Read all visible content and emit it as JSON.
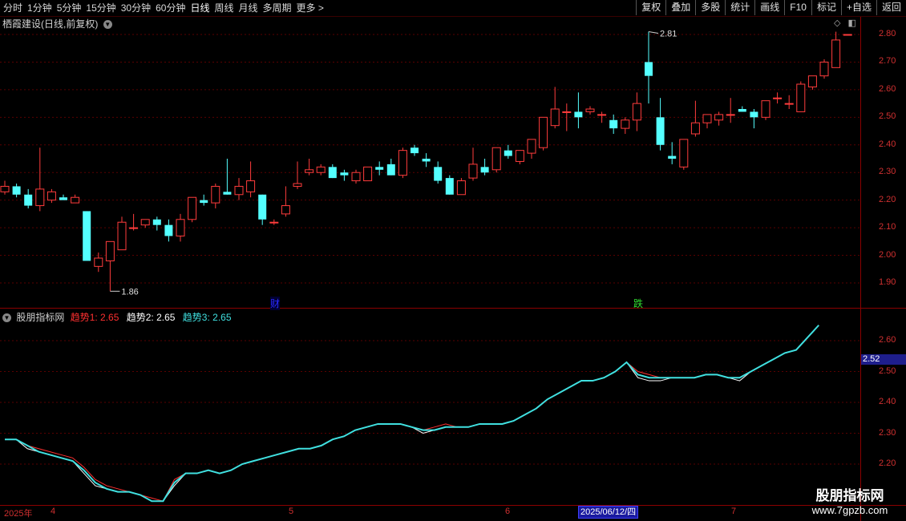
{
  "toolbar": {
    "periods": [
      "分时",
      "1分钟",
      "5分钟",
      "15分钟",
      "30分钟",
      "60分钟",
      "日线",
      "周线",
      "月线",
      "多周期",
      "更多 >"
    ],
    "active": "日线",
    "right_buttons": [
      "复权",
      "叠加",
      "多股",
      "统计",
      "画线",
      "F10",
      "标记",
      "+自选",
      "返回"
    ]
  },
  "stock": {
    "title": "栖霞建设(日线,前复权)"
  },
  "price_axis": {
    "ticks": [
      "2.80",
      "2.70",
      "2.60",
      "2.50",
      "2.40",
      "2.30",
      "2.20",
      "2.10",
      "2.00",
      "1.90"
    ],
    "min": 1.86,
    "max": 2.81
  },
  "annotations": {
    "high": "2.81",
    "low": "1.86",
    "marker_cai": "财",
    "marker_die": "跌"
  },
  "indicator": {
    "name": "股朋指标网",
    "series_labels": [
      "趋势1: 2.65",
      "趋势2: 2.65",
      "趋势3: 2.65"
    ],
    "colors": [
      "#ff3030",
      "#ffffff",
      "#40e0e0"
    ],
    "axis_ticks": [
      "2.60",
      "2.50",
      "2.40",
      "2.30",
      "2.20"
    ],
    "current_value": "2.52"
  },
  "dates": {
    "labels": [
      "2025年",
      "4",
      "5",
      "6",
      "2025/06/12/四",
      "7"
    ]
  },
  "watermark": {
    "title": "股朋指标网",
    "url": "www.7gpzb.com"
  },
  "chart_data": {
    "type": "candlestick",
    "ohlc": [
      [
        2.23,
        2.27,
        2.22,
        2.25
      ],
      [
        2.25,
        2.26,
        2.21,
        2.22
      ],
      [
        2.22,
        2.24,
        2.17,
        2.18
      ],
      [
        2.18,
        2.39,
        2.16,
        2.24
      ],
      [
        2.2,
        2.24,
        2.19,
        2.23
      ],
      [
        2.21,
        2.22,
        2.2,
        2.2
      ],
      [
        2.19,
        2.22,
        2.19,
        2.21
      ],
      [
        2.16,
        2.16,
        2.02,
        1.98
      ],
      [
        1.96,
        2.01,
        1.94,
        1.99
      ],
      [
        1.98,
        2.05,
        1.87,
        2.05
      ],
      [
        2.02,
        2.14,
        2.02,
        2.12
      ],
      [
        2.1,
        2.15,
        2.09,
        2.1
      ],
      [
        2.11,
        2.13,
        2.1,
        2.13
      ],
      [
        2.13,
        2.14,
        2.09,
        2.11
      ],
      [
        2.11,
        2.13,
        2.05,
        2.07
      ],
      [
        2.07,
        2.15,
        2.05,
        2.13
      ],
      [
        2.13,
        2.21,
        2.12,
        2.21
      ],
      [
        2.2,
        2.22,
        2.18,
        2.19
      ],
      [
        2.19,
        2.26,
        2.17,
        2.25
      ],
      [
        2.23,
        2.35,
        2.22,
        2.22
      ],
      [
        2.22,
        2.28,
        2.2,
        2.25
      ],
      [
        2.23,
        2.34,
        2.21,
        2.27
      ],
      [
        2.22,
        2.22,
        2.11,
        2.13
      ],
      [
        2.12,
        2.13,
        2.11,
        2.12
      ],
      [
        2.15,
        2.25,
        2.14,
        2.18
      ],
      [
        2.25,
        2.34,
        2.24,
        2.26
      ],
      [
        2.3,
        2.35,
        2.29,
        2.31
      ],
      [
        2.3,
        2.33,
        2.29,
        2.32
      ],
      [
        2.32,
        2.33,
        2.28,
        2.28
      ],
      [
        2.3,
        2.31,
        2.27,
        2.29
      ],
      [
        2.27,
        2.31,
        2.26,
        2.3
      ],
      [
        2.27,
        2.32,
        2.27,
        2.32
      ],
      [
        2.32,
        2.34,
        2.29,
        2.31
      ],
      [
        2.33,
        2.35,
        2.29,
        2.29
      ],
      [
        2.29,
        2.39,
        2.28,
        2.38
      ],
      [
        2.39,
        2.4,
        2.36,
        2.37
      ],
      [
        2.35,
        2.37,
        2.32,
        2.34
      ],
      [
        2.32,
        2.34,
        2.26,
        2.27
      ],
      [
        2.28,
        2.29,
        2.22,
        2.22
      ],
      [
        2.22,
        2.28,
        2.22,
        2.27
      ],
      [
        2.28,
        2.39,
        2.27,
        2.33
      ],
      [
        2.32,
        2.35,
        2.29,
        2.3
      ],
      [
        2.31,
        2.38,
        2.3,
        2.39
      ],
      [
        2.38,
        2.4,
        2.35,
        2.36
      ],
      [
        2.34,
        2.38,
        2.33,
        2.38
      ],
      [
        2.37,
        2.42,
        2.35,
        2.42
      ],
      [
        2.39,
        2.47,
        2.38,
        2.5
      ],
      [
        2.47,
        2.61,
        2.46,
        2.53
      ],
      [
        2.52,
        2.55,
        2.45,
        2.52
      ],
      [
        2.52,
        2.59,
        2.46,
        2.5
      ],
      [
        2.52,
        2.54,
        2.51,
        2.53
      ],
      [
        2.51,
        2.52,
        2.48,
        2.51
      ],
      [
        2.49,
        2.51,
        2.44,
        2.46
      ],
      [
        2.46,
        2.5,
        2.44,
        2.49
      ],
      [
        2.49,
        2.59,
        2.45,
        2.55
      ],
      [
        2.7,
        2.81,
        2.55,
        2.65
      ],
      [
        2.5,
        2.57,
        2.38,
        2.4
      ],
      [
        2.36,
        2.41,
        2.33,
        2.35
      ],
      [
        2.32,
        2.42,
        2.31,
        2.42
      ],
      [
        2.44,
        2.56,
        2.43,
        2.48
      ],
      [
        2.48,
        2.51,
        2.46,
        2.51
      ],
      [
        2.49,
        2.52,
        2.47,
        2.51
      ],
      [
        2.51,
        2.57,
        2.48,
        2.51
      ],
      [
        2.53,
        2.54,
        2.52,
        2.52
      ],
      [
        2.52,
        2.53,
        2.46,
        2.5
      ],
      [
        2.5,
        2.56,
        2.49,
        2.56
      ],
      [
        2.57,
        2.59,
        2.55,
        2.57
      ],
      [
        2.55,
        2.58,
        2.53,
        2.55
      ],
      [
        2.52,
        2.63,
        2.52,
        2.62
      ],
      [
        2.61,
        2.65,
        2.6,
        2.65
      ],
      [
        2.65,
        2.71,
        2.64,
        2.7
      ],
      [
        2.68,
        2.81,
        2.68,
        2.78
      ],
      [
        2.8,
        2.8,
        2.8,
        2.8
      ]
    ],
    "trend_lines": [
      [
        2.28,
        2.28,
        2.26,
        2.25,
        2.24,
        2.23,
        2.22,
        2.19,
        2.15,
        2.13,
        2.12,
        2.11,
        2.1,
        2.09,
        2.08,
        2.15,
        2.17,
        2.17,
        2.18,
        2.17,
        2.18,
        2.2,
        2.21,
        2.22,
        2.23,
        2.24,
        2.25,
        2.25,
        2.26,
        2.28,
        2.29,
        2.31,
        2.32,
        2.33,
        2.33,
        2.33,
        2.32,
        2.31,
        2.32,
        2.33,
        2.32,
        2.32,
        2.33,
        2.33,
        2.33,
        2.34,
        2.36,
        2.38,
        2.41,
        2.43,
        2.45,
        2.47,
        2.47,
        2.48,
        2.5,
        2.53,
        2.5,
        2.49,
        2.48,
        2.48,
        2.48,
        2.48,
        2.49,
        2.49,
        2.48,
        2.48,
        2.5,
        2.52,
        2.54,
        2.56,
        2.57,
        2.61,
        2.65
      ],
      [
        2.28,
        2.28,
        2.25,
        2.24,
        2.23,
        2.22,
        2.21,
        2.17,
        2.13,
        2.12,
        2.11,
        2.11,
        2.1,
        2.08,
        2.08,
        2.13,
        2.17,
        2.17,
        2.18,
        2.17,
        2.18,
        2.2,
        2.21,
        2.22,
        2.23,
        2.24,
        2.25,
        2.25,
        2.26,
        2.28,
        2.29,
        2.31,
        2.32,
        2.33,
        2.33,
        2.33,
        2.32,
        2.3,
        2.31,
        2.32,
        2.32,
        2.32,
        2.33,
        2.33,
        2.33,
        2.34,
        2.36,
        2.38,
        2.41,
        2.43,
        2.45,
        2.47,
        2.47,
        2.48,
        2.5,
        2.53,
        2.48,
        2.47,
        2.47,
        2.48,
        2.48,
        2.48,
        2.49,
        2.49,
        2.48,
        2.47,
        2.5,
        2.52,
        2.54,
        2.56,
        2.57,
        2.61,
        2.65
      ],
      [
        2.28,
        2.28,
        2.26,
        2.24,
        2.23,
        2.22,
        2.21,
        2.18,
        2.14,
        2.12,
        2.11,
        2.11,
        2.1,
        2.08,
        2.08,
        2.14,
        2.17,
        2.17,
        2.18,
        2.17,
        2.18,
        2.2,
        2.21,
        2.22,
        2.23,
        2.24,
        2.25,
        2.25,
        2.26,
        2.28,
        2.29,
        2.31,
        2.32,
        2.33,
        2.33,
        2.33,
        2.32,
        2.31,
        2.31,
        2.32,
        2.32,
        2.32,
        2.33,
        2.33,
        2.33,
        2.34,
        2.36,
        2.38,
        2.41,
        2.43,
        2.45,
        2.47,
        2.47,
        2.48,
        2.5,
        2.53,
        2.49,
        2.48,
        2.48,
        2.48,
        2.48,
        2.48,
        2.49,
        2.49,
        2.48,
        2.48,
        2.5,
        2.52,
        2.54,
        2.56,
        2.57,
        2.61,
        2.65
      ]
    ],
    "ylim_price": [
      1.86,
      2.81
    ],
    "ylim_indicator": [
      2.15,
      2.65
    ]
  }
}
